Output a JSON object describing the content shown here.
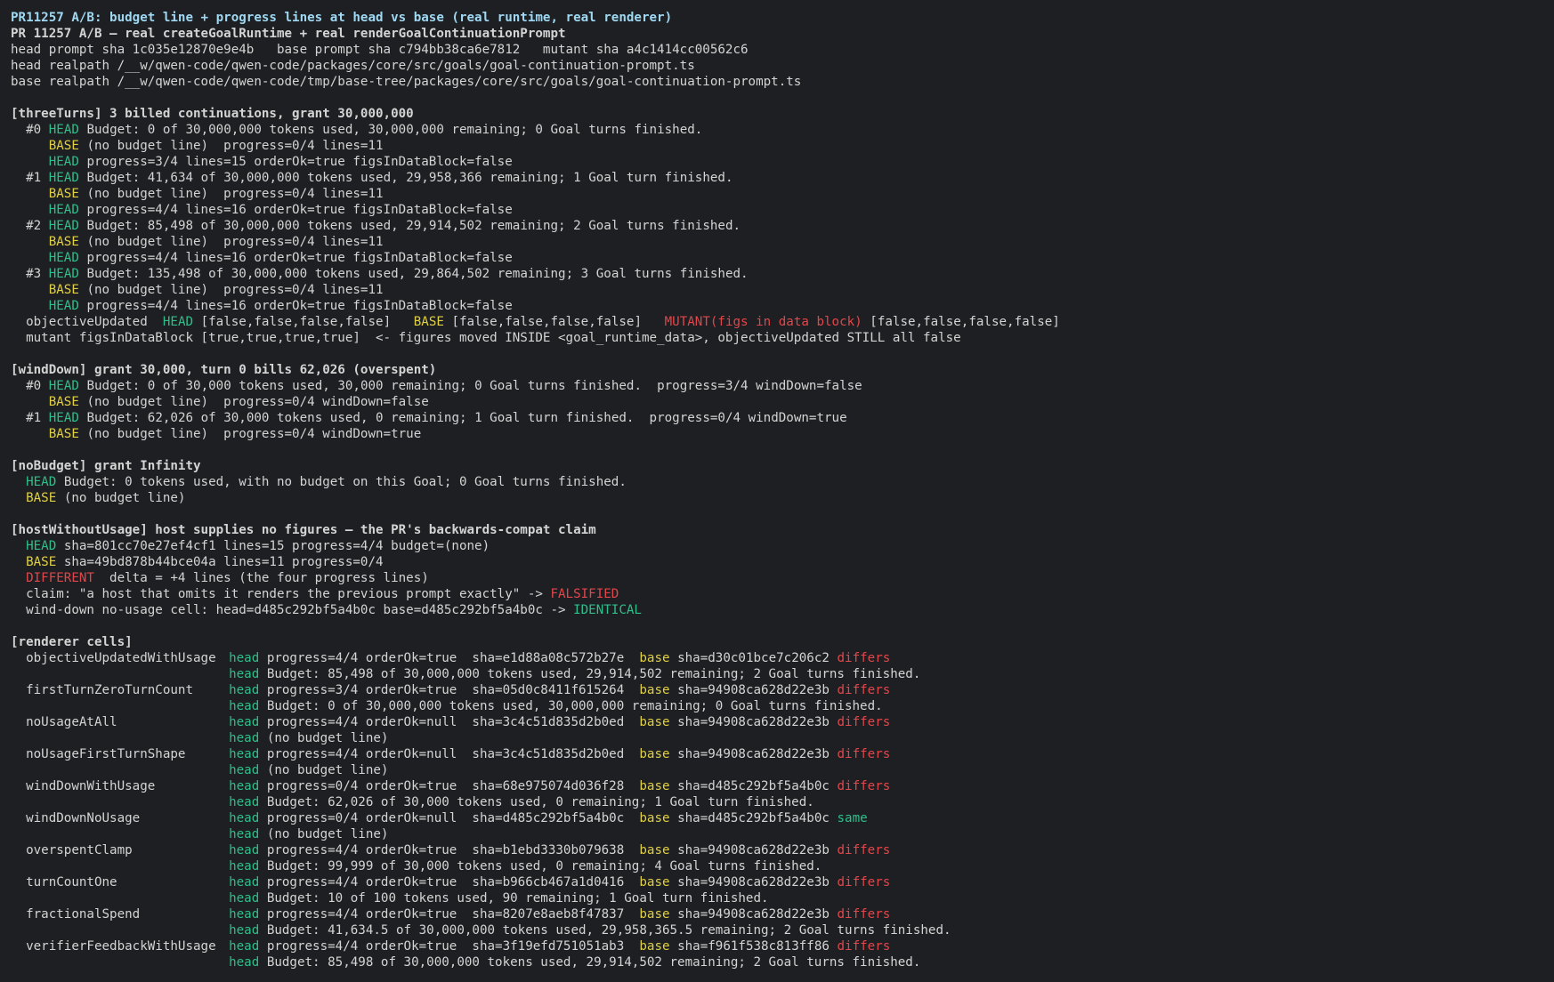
{
  "colors": {
    "background": "#1e1f22",
    "text": "#d4d4d4",
    "title": "#9fd8f2",
    "head": "#2fbf8a",
    "base": "#e0d043",
    "red": "#e0474c"
  },
  "header": {
    "title": "PR11257 A/B: budget line + progress lines at head vs base (real runtime, real renderer)",
    "subtitle": "PR 11257 A/B — real createGoalRuntime + real renderGoalContinuationPrompt",
    "shas": "head prompt sha 1c035e12870e9e4b   base prompt sha c794bb38ca6e7812   mutant sha a4c1414cc00562c6",
    "head_realpath": "head realpath /__w/qwen-code/qwen-code/packages/core/src/goals/goal-continuation-prompt.ts",
    "base_realpath": "base realpath /__w/qwen-code/qwen-code/tmp/base-tree/packages/core/src/goals/goal-continuation-prompt.ts"
  },
  "tags": {
    "head_upper": "HEAD",
    "base_upper": "BASE",
    "head_lower": "head",
    "base_lower": "base",
    "differs": "differs",
    "same": "same"
  },
  "three_turns": {
    "heading": "[threeTurns] 3 billed continuations, grant 30,000,000",
    "turns": [
      {
        "idx": "#0",
        "head_budget": "Budget: 0 of 30,000,000 tokens used, 30,000,000 remaining; 0 Goal turns finished.",
        "base": "(no budget line)  progress=0/4 lines=11",
        "head_progress": "progress=3/4 lines=15 orderOk=true figsInDataBlock=false"
      },
      {
        "idx": "#1",
        "head_budget": "Budget: 41,634 of 30,000,000 tokens used, 29,958,366 remaining; 1 Goal turn finished.",
        "base": "(no budget line)  progress=0/4 lines=11",
        "head_progress": "progress=4/4 lines=16 orderOk=true figsInDataBlock=false"
      },
      {
        "idx": "#2",
        "head_budget": "Budget: 85,498 of 30,000,000 tokens used, 29,914,502 remaining; 2 Goal turns finished.",
        "base": "(no budget line)  progress=0/4 lines=11",
        "head_progress": "progress=4/4 lines=16 orderOk=true figsInDataBlock=false"
      },
      {
        "idx": "#3",
        "head_budget": "Budget: 135,498 of 30,000,000 tokens used, 29,864,502 remaining; 3 Goal turns finished.",
        "base": "(no budget line)  progress=0/4 lines=11",
        "head_progress": "progress=4/4 lines=16 orderOk=true figsInDataBlock=false"
      }
    ],
    "objective_label": "objectiveUpdated",
    "objective_head": "[false,false,false,false]",
    "objective_base": "[false,false,false,false]",
    "mutant_label": "MUTANT(figs in data block)",
    "objective_mutant": "[false,false,false,false]",
    "mutant_line": "mutant figsInDataBlock [true,true,true,true]  <- figures moved INSIDE <goal_runtime_data>, objectiveUpdated STILL all false"
  },
  "wind_down": {
    "heading": "[windDown] grant 30,000, turn 0 bills 62,026 (overspent)",
    "turns": [
      {
        "idx": "#0",
        "head": "Budget: 0 of 30,000 tokens used, 30,000 remaining; 0 Goal turns finished.  progress=3/4 windDown=false",
        "base": "(no budget line)  progress=0/4 windDown=false"
      },
      {
        "idx": "#1",
        "head": "Budget: 62,026 of 30,000 tokens used, 0 remaining; 1 Goal turn finished.  progress=0/4 windDown=true",
        "base": "(no budget line)  progress=0/4 windDown=true"
      }
    ]
  },
  "no_budget": {
    "heading": "[noBudget] grant Infinity",
    "head": "Budget: 0 tokens used, with no budget on this Goal; 0 Goal turns finished.",
    "base": "(no budget line)"
  },
  "host_without_usage": {
    "heading": "[hostWithoutUsage] host supplies no figures — the PR's backwards-compat claim",
    "head": "sha=801cc70e27ef4cf1 lines=15 progress=4/4 budget=(none)",
    "base": "sha=49bd878b44bce04a lines=11 progress=0/4",
    "different_label": "DIFFERENT",
    "different_text": "  delta = +4 lines (the four progress lines)",
    "claim_text": "claim: \"a host that omits it renders the previous prompt exactly\" -> ",
    "claim_result": "FALSIFIED",
    "winddown_text": "wind-down no-usage cell: head=d485c292bf5a4b0c base=d485c292bf5a4b0c -> ",
    "winddown_result": "IDENTICAL"
  },
  "renderer_cells": {
    "heading": "[renderer cells]",
    "cells": [
      {
        "name": "objectiveUpdatedWithUsage",
        "head": "progress=4/4 orderOk=true  sha=e1d88a08c572b27e",
        "base": "sha=d30c01bce7c206c2",
        "verdict": "differs",
        "detail": "Budget: 85,498 of 30,000,000 tokens used, 29,914,502 remaining; 2 Goal turns finished."
      },
      {
        "name": "firstTurnZeroTurnCount",
        "head": "progress=3/4 orderOk=true  sha=05d0c8411f615264",
        "base": "sha=94908ca628d22e3b",
        "verdict": "differs",
        "detail": "Budget: 0 of 30,000,000 tokens used, 30,000,000 remaining; 0 Goal turns finished."
      },
      {
        "name": "noUsageAtAll",
        "head": "progress=4/4 orderOk=null  sha=3c4c51d835d2b0ed",
        "base": "sha=94908ca628d22e3b",
        "verdict": "differs",
        "detail": "(no budget line)"
      },
      {
        "name": "noUsageFirstTurnShape",
        "head": "progress=4/4 orderOk=null  sha=3c4c51d835d2b0ed",
        "base": "sha=94908ca628d22e3b",
        "verdict": "differs",
        "detail": "(no budget line)"
      },
      {
        "name": "windDownWithUsage",
        "head": "progress=0/4 orderOk=true  sha=68e975074d036f28",
        "base": "sha=d485c292bf5a4b0c",
        "verdict": "differs",
        "detail": "Budget: 62,026 of 30,000 tokens used, 0 remaining; 1 Goal turn finished."
      },
      {
        "name": "windDownNoUsage",
        "head": "progress=0/4 orderOk=null  sha=d485c292bf5a4b0c",
        "base": "sha=d485c292bf5a4b0c",
        "verdict": "same",
        "detail": "(no budget line)"
      },
      {
        "name": "overspentClamp",
        "head": "progress=4/4 orderOk=true  sha=b1ebd3330b079638",
        "base": "sha=94908ca628d22e3b",
        "verdict": "differs",
        "detail": "Budget: 99,999 of 30,000 tokens used, 0 remaining; 4 Goal turns finished."
      },
      {
        "name": "turnCountOne",
        "head": "progress=4/4 orderOk=true  sha=b966cb467a1d0416",
        "base": "sha=94908ca628d22e3b",
        "verdict": "differs",
        "detail": "Budget: 10 of 100 tokens used, 90 remaining; 1 Goal turn finished."
      },
      {
        "name": "fractionalSpend",
        "head": "progress=4/4 orderOk=true  sha=8207e8aeb8f47837",
        "base": "sha=94908ca628d22e3b",
        "verdict": "differs",
        "detail": "Budget: 41,634.5 of 30,000,000 tokens used, 29,958,365.5 remaining; 2 Goal turns finished."
      },
      {
        "name": "verifierFeedbackWithUsage",
        "head": "progress=4/4 orderOk=true  sha=3f19efd751051ab3",
        "base": "sha=f961f538c813ff86",
        "verdict": "differs",
        "detail": "Budget: 85,498 of 30,000,000 tokens used, 29,914,502 remaining; 2 Goal turns finished."
      }
    ]
  }
}
